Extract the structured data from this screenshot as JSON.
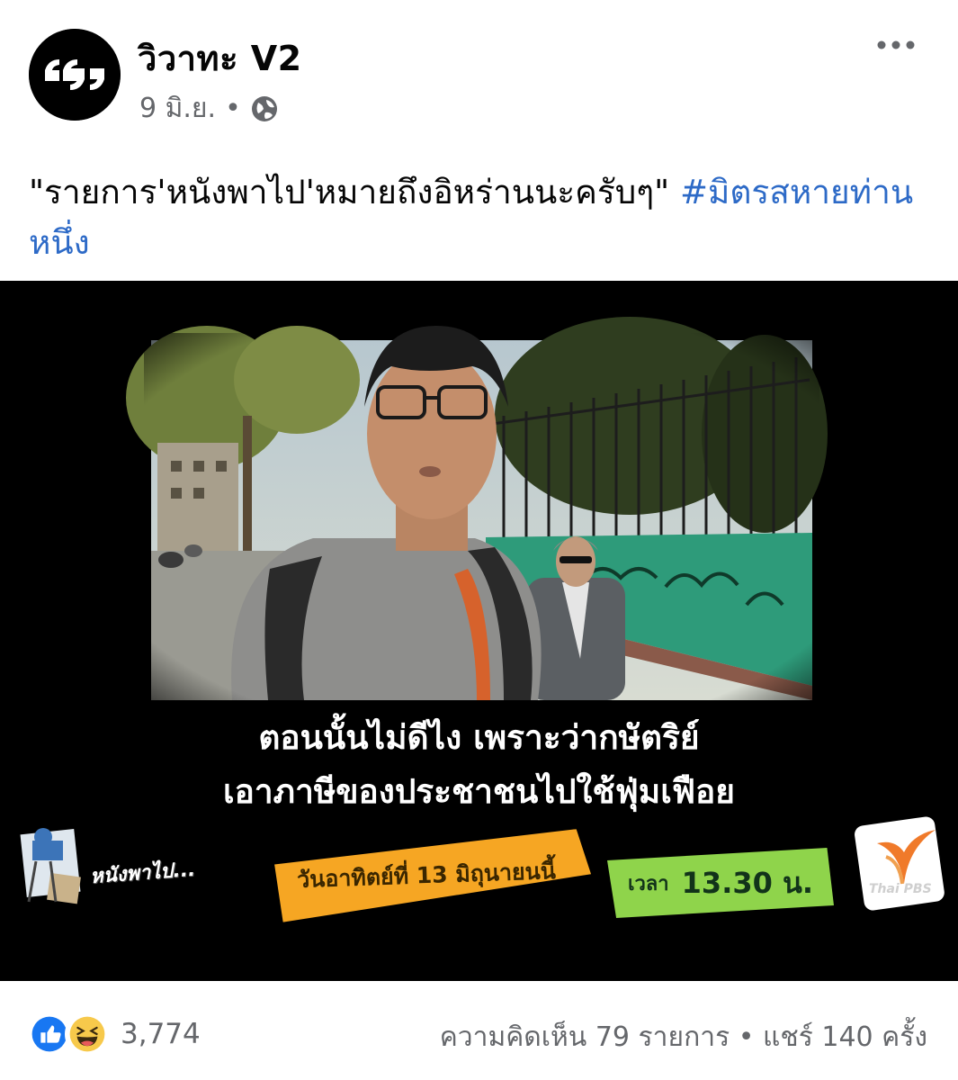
{
  "post": {
    "page_name": "วิวาทะ V2",
    "date": "9 มิ.ย.",
    "separator": "•",
    "privacy_icon": "globe-icon",
    "more_icon": "more-horizontal-icon",
    "caption_text": "\"รายการ'หนังพาไป'หมายถึงอิหร่านนะครับๆ\" ",
    "caption_hashtag": "#มิตรสหายท่านหนึ่ง"
  },
  "media": {
    "subtitle_line1": "ตอนนั้นไม่ดีไง เพราะว่ากษัตริย์",
    "subtitle_line2": "เอาภาษีของประชาชนไปใช้ฟุ่มเฟือย",
    "show_logo": "หนังพาไป...",
    "air_date": "วันอาทิตย์ที่ 13 มิถุนายนนี้",
    "time_label": "เวลา",
    "time_value": "13.30 น.",
    "channel_logo": "Thai PBS"
  },
  "footer": {
    "reaction_icons": [
      "like-icon",
      "haha-icon"
    ],
    "reaction_count": "3,774",
    "comments": "ความคิดเห็น 79 รายการ",
    "separator": "•",
    "shares": "แชร์ 140 ครั้ง"
  },
  "colors": {
    "hashtag": "#2d6ac7",
    "meta_text": "#65676b",
    "like_blue": "#1877f2",
    "haha_yellow": "#f7c94b",
    "date_banner": "#f6a623",
    "time_banner": "#8fd44b",
    "wall_green": "#2e9b7a"
  }
}
